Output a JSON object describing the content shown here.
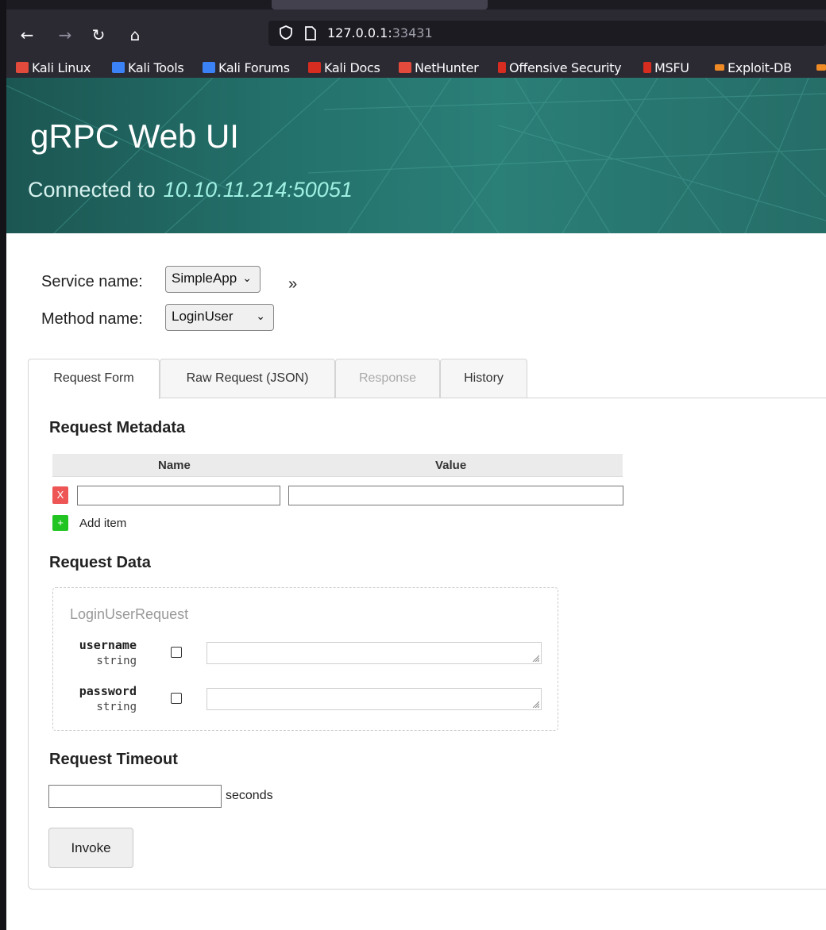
{
  "browser": {
    "url_host": "127.0.0.1:",
    "url_port": "33431",
    "bookmarks": [
      {
        "label": "Kali Linux",
        "color": "#e24a3b"
      },
      {
        "label": "Kali Tools",
        "color": "#3b82f6"
      },
      {
        "label": "Kali Forums",
        "color": "#3b82f6"
      },
      {
        "label": "Kali Docs",
        "color": "#d62d20"
      },
      {
        "label": "NetHunter",
        "color": "#e24a3b"
      },
      {
        "label": "Offensive Security",
        "color": "#d62d20"
      },
      {
        "label": "MSFU",
        "color": "#d62d20"
      },
      {
        "label": "Exploit-DB",
        "color": "#f08a24"
      }
    ]
  },
  "hero": {
    "title": "gRPC  Web UI",
    "connected_label": "Connected to",
    "address": "10.10.11.214:50051"
  },
  "selectors": {
    "service_label": "Service name:",
    "service_value": "SimpleApp",
    "method_label": "Method name:",
    "method_value": "LoginUser",
    "expand": "»"
  },
  "tabs": [
    {
      "label": "Request Form",
      "state": "active"
    },
    {
      "label": "Raw Request (JSON)",
      "state": "normal"
    },
    {
      "label": "Response",
      "state": "disabled"
    },
    {
      "label": "History",
      "state": "normal"
    }
  ],
  "metadata": {
    "heading": "Request Metadata",
    "col_name": "Name",
    "col_value": "Value",
    "remove_label": "X",
    "add_icon": "+",
    "add_label": "Add item"
  },
  "request_data": {
    "heading": "Request Data",
    "message_name": "LoginUserRequest",
    "fields": [
      {
        "name": "username",
        "type": "string"
      },
      {
        "name": "password",
        "type": "string"
      }
    ]
  },
  "timeout": {
    "heading": "Request Timeout",
    "unit": "seconds"
  },
  "invoke_label": "Invoke",
  "colors": {
    "hero_bg": "#24726c",
    "remove_btn": "#ee5555",
    "add_btn": "#22c422"
  }
}
